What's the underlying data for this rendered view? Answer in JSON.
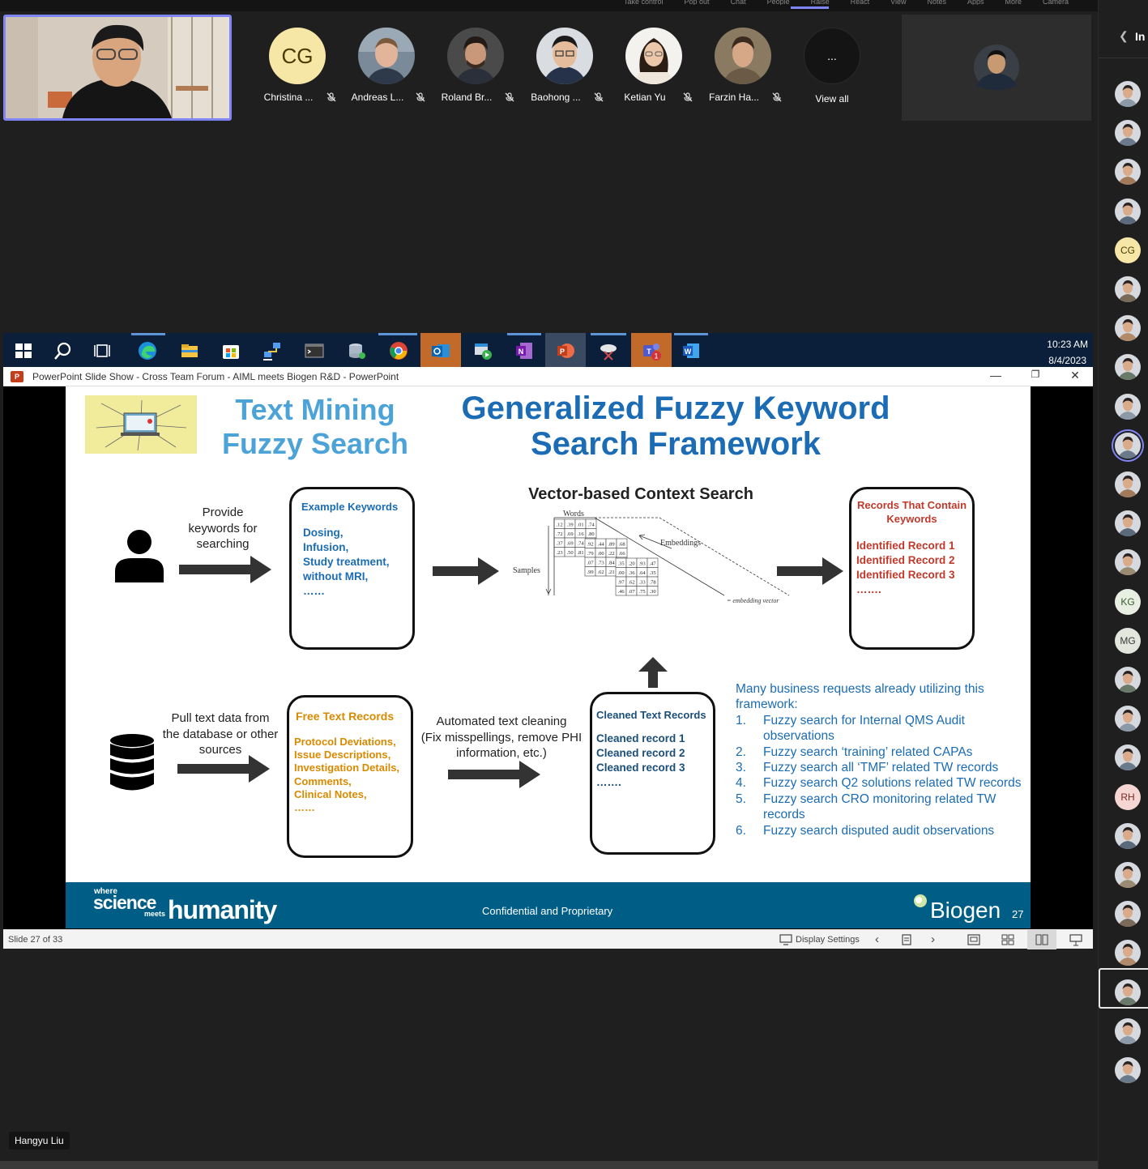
{
  "meeting": {
    "top_menu": [
      "Take control",
      "Pop out",
      "Chat",
      "People",
      "Raise",
      "React",
      "View",
      "Notes",
      "Apps",
      "More",
      "Camera"
    ],
    "participants": [
      {
        "name": "Christina ...",
        "initials": "CG",
        "muted": true
      },
      {
        "name": "Andreas L...",
        "muted": true
      },
      {
        "name": "Roland Br...",
        "muted": true
      },
      {
        "name": "Baohong ...",
        "muted": true
      },
      {
        "name": "Ketian Yu",
        "muted": true
      },
      {
        "name": "Farzin Ha...",
        "muted": true
      }
    ],
    "view_all_icon": "...",
    "view_all_label": "View all",
    "roster_title": "In",
    "roster_initials": [
      "CG",
      "KG",
      "MG",
      "RH"
    ],
    "presenter_name": "Hangyu Liu"
  },
  "taskbar": {
    "time": "10:23 AM",
    "date": "8/4/2023",
    "icons": [
      "start-icon",
      "search-icon",
      "task-view-icon",
      "edge-icon",
      "file-explorer-icon",
      "store-icon",
      "network-icon",
      "terminal-icon",
      "app-icon",
      "chrome-icon",
      "outlook-icon",
      "player-icon",
      "onenote-icon",
      "powerpoint-icon",
      "snip-icon",
      "teams-icon",
      "word-icon"
    ],
    "teams_badge": "1"
  },
  "ppt": {
    "window_title": "PowerPoint Slide Show  -  Cross Team Forum - AIML meets Biogen R&D - PowerPoint",
    "status_left": "Slide 27 of 33",
    "display_settings": "Display Settings"
  },
  "slide": {
    "title_left": [
      "Text Mining",
      "Fuzzy Search"
    ],
    "title_main": [
      "Generalized Fuzzy Keyword",
      "Search Framework"
    ],
    "provide_text": [
      "Provide",
      "keywords for",
      "searching"
    ],
    "example_box": {
      "title": "Example Keywords",
      "lines": [
        "Dosing,",
        "Infusion,",
        "Study treatment,",
        "without MRI,",
        "……"
      ]
    },
    "vector_title": "Vector-based Context Search",
    "vector_labels": {
      "words": "Words",
      "embeddings": "Embeddings",
      "samples": "Samples",
      "embedding_vector": "= embedding vector"
    },
    "records_box": {
      "title": [
        "Records That Contain",
        "Keywords"
      ],
      "lines": [
        "Identified Record 1",
        "Identified Record 2",
        "Identified Record 3",
        "……."
      ]
    },
    "pull_text": [
      "Pull text data from",
      "the database or other",
      "sources"
    ],
    "free_box": {
      "title": "Free Text Records",
      "lines": [
        "Protocol Deviations,",
        "Issue Descriptions,",
        "Investigation Details,",
        "Comments,",
        "Clinical Notes,",
        "……"
      ]
    },
    "cleaning_text": [
      "Automated text cleaning",
      "(Fix misspellings, remove PHI",
      "information, etc.)"
    ],
    "cleaned_box": {
      "title": "Cleaned Text Records",
      "lines": [
        "Cleaned record 1",
        "Cleaned record 2",
        "Cleaned record 3",
        "……."
      ]
    },
    "usecases_intro": [
      "Many business requests already utilizing this",
      "framework:"
    ],
    "usecases": [
      {
        "num": "1.",
        "text": "Fuzzy search for Internal QMS Audit observations"
      },
      {
        "num": "2.",
        "text": "Fuzzy search ‘training’ related CAPAs"
      },
      {
        "num": "3.",
        "text": "Fuzzy search all ‘TMF’ related TW records"
      },
      {
        "num": "4.",
        "text": "Fuzzy search Q2 solutions related TW records"
      },
      {
        "num": "5.",
        "text": "Fuzzy search CRO monitoring related TW records"
      },
      {
        "num": "6.",
        "text": "Fuzzy search disputed audit observations"
      }
    ],
    "footer": {
      "tag_where": "where",
      "tag_science": "science",
      "tag_meets": "meets",
      "tag_humanity": "humanity",
      "confidential": "Confidential and Proprietary",
      "brand": "Biogen",
      "page_number": "27"
    },
    "matrix_values": [
      ".12",
      ".39",
      ".01",
      ".74",
      ".72",
      ".69",
      ".16",
      ".80",
      ".37",
      ".69",
      ".74",
      ".90",
      ".23",
      ".50",
      ".81",
      ".33",
      ".92",
      ".44",
      ".89",
      ".68",
      ".79",
      ".00",
      ".22",
      ".66",
      ".07",
      ".73",
      ".84",
      ".84",
      ".99",
      ".62",
      ".21",
      ".64",
      ".35",
      ".20",
      ".93",
      ".47",
      ".00",
      ".36",
      ".64",
      ".35",
      ".97",
      ".62",
      ".33",
      ".78",
      ".46",
      ".07",
      ".75",
      ".30"
    ]
  },
  "colors": {
    "accent": "#7f85f5",
    "slide_blue": "#1b6cb4",
    "slide_light_blue": "#4ba3d8",
    "orange": "#d98a00",
    "red": "#c0392b",
    "footer": "#005e86"
  }
}
